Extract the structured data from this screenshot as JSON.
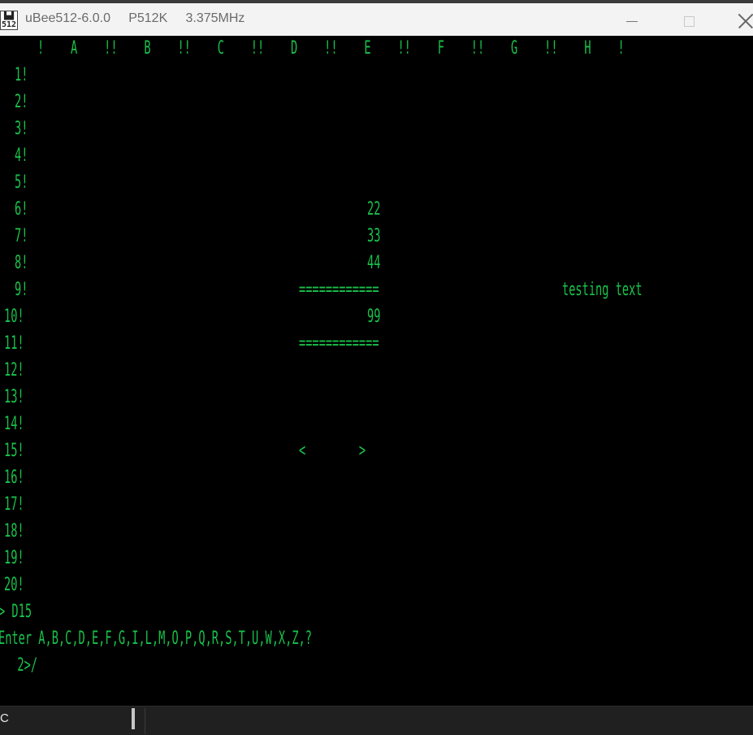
{
  "window": {
    "title": "uBee512-6.0.0     P512K     3.375MHz",
    "icon_glyph": "▙▟ 512"
  },
  "spreadsheet": {
    "header": "!    A    !!    B    !!    C    !!    D    !!    E    !!    F    !!    G    !!    H    !",
    "rows": [
      "1!",
      "2!",
      "3!",
      "4!",
      "5!",
      "6!",
      "7!",
      "8!",
      "9!",
      "10!",
      "11!",
      "12!",
      "13!",
      "14!",
      "15!",
      "16!",
      "17!",
      "18!",
      "19!",
      "20!"
    ],
    "cells": {
      "d6": "22",
      "d7": "33",
      "d8": "44",
      "d9": "============",
      "g9": "testing text",
      "d10": "99",
      "d11": "============",
      "d15": "<        >"
    }
  },
  "prompt": {
    "line1": "> D15",
    "line2": "Enter A,B,C,D,E,F,G,I,L,M,O,P,Q,R,S,T,U,W,X,Z,?",
    "line3": "  2>/"
  },
  "statusbar": {
    "text": "C"
  },
  "colors": {
    "terminal_green": "#19c24a",
    "background": "#000000"
  }
}
